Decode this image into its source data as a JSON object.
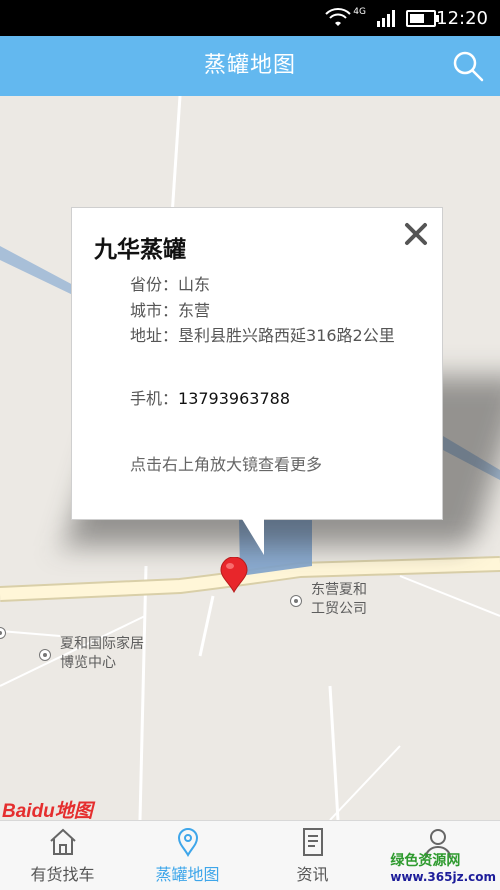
{
  "status_bar": {
    "network": "4G",
    "time": "12:20"
  },
  "header": {
    "title": "蒸罐地图"
  },
  "popup": {
    "title": "九华蒸罐",
    "province_label": "省份：",
    "province": "山东",
    "city_label": "城市：",
    "city": "东营",
    "address_label": "地址：",
    "address": "垦利县胜兴路西延316路2公里",
    "phone_label": "手机：",
    "phone": "13793963788",
    "hint": "点击右上角放大镜查看更多"
  },
  "map": {
    "poi_1": "东营夏和工贸公司",
    "poi_2": "夏和国际家居博览中心",
    "logo": "Baidu地图"
  },
  "bottom_nav": {
    "items": [
      {
        "label": "有货找车",
        "icon": "home-icon"
      },
      {
        "label": "蒸罐地图",
        "icon": "location-pin-icon"
      },
      {
        "label": "资讯",
        "icon": "document-icon"
      },
      {
        "label": "",
        "icon": "person-icon"
      }
    ]
  },
  "watermark": {
    "line1": "绿色资源网",
    "line2": "www.365jz.com"
  },
  "colors": {
    "header": "#63b8ef",
    "active_tab": "#3ea6ea",
    "marker": "#e8262b"
  }
}
